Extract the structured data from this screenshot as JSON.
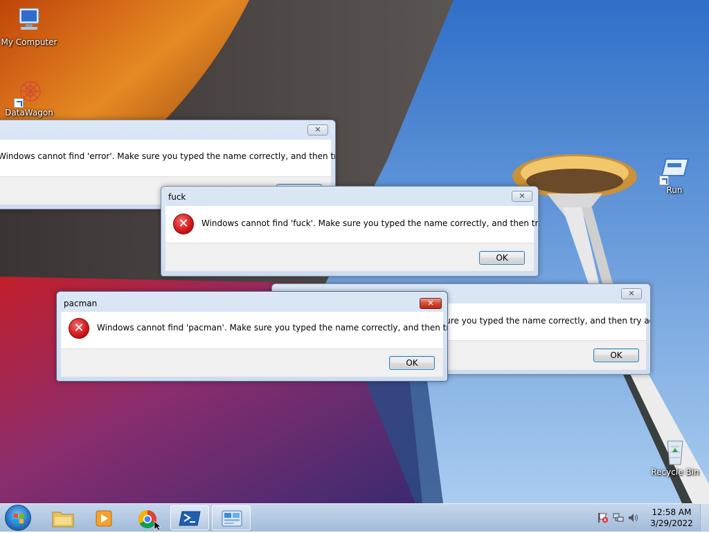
{
  "desktop": {
    "icons": {
      "my_computer": "My Computer",
      "data_wagon": "DataWagon",
      "run": "Run",
      "recycle_bin": "Recycle Bin"
    }
  },
  "dialogs": {
    "error": {
      "title": "",
      "message": "Windows cannot find 'error'. Make sure you typed the name correctly, and then try again.",
      "ok_label": "OK"
    },
    "fuck": {
      "title": "fuck",
      "message": "Windows cannot find 'fuck'. Make sure you typed the name correctly, and then try again.",
      "ok_label": "OK"
    },
    "hidden": {
      "message": "sure you typed the name correctly, and then try again.",
      "ok_label": "OK"
    },
    "pacman": {
      "title": "pacman",
      "message": "Windows cannot find 'pacman'. Make sure you typed the name correctly, and then try again.",
      "ok_label": "OK"
    }
  },
  "taskbar": {
    "clock_time": "12:58 AM",
    "clock_date": "3/29/2022",
    "pinned": [
      "start-orb",
      "explorer-icon",
      "media-player-icon",
      "chrome-icon",
      "powershell-icon",
      "control-panel-icon"
    ]
  },
  "colors": {
    "error_red": "#d41a1a",
    "taskbar": "#b4c8e0",
    "dialog_frame": "#cddcef"
  }
}
